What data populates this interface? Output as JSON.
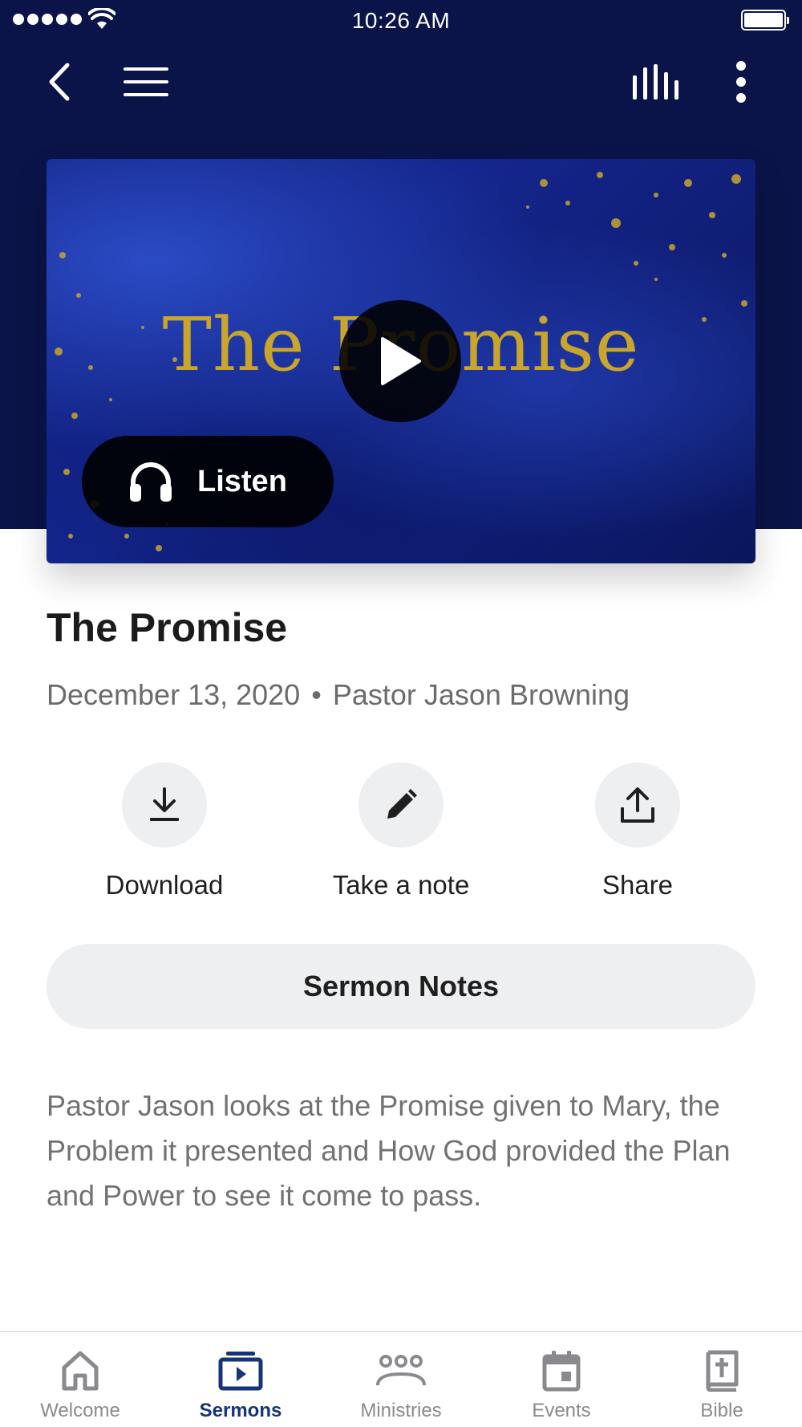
{
  "status_bar": {
    "time": "10:26 AM"
  },
  "header": {
    "back_icon": "chevron-left-icon",
    "menu_icon": "hamburger-icon",
    "audio_icon": "equalizer-icon",
    "more_icon": "vertical-dots-icon"
  },
  "artwork": {
    "text": "The Promise",
    "play_icon": "play-icon",
    "listen_label": "Listen",
    "listen_icon": "headphones-icon"
  },
  "sermon": {
    "title": "The Promise",
    "date": "December 13, 2020",
    "separator": "•",
    "speaker": "Pastor Jason Browning",
    "description": "Pastor Jason looks at the Promise given to Mary, the Problem it presented and How God provided the Plan and Power to see it come to pass."
  },
  "actions": [
    {
      "label": "Download",
      "icon": "download-icon"
    },
    {
      "label": "Take a note",
      "icon": "pencil-icon"
    },
    {
      "label": "Share",
      "icon": "share-icon"
    }
  ],
  "notes_button": {
    "label": "Sermon Notes"
  },
  "tabs": [
    {
      "label": "Welcome",
      "icon": "home-icon",
      "active": false
    },
    {
      "label": "Sermons",
      "icon": "video-library-icon",
      "active": true
    },
    {
      "label": "Ministries",
      "icon": "groups-icon",
      "active": false
    },
    {
      "label": "Events",
      "icon": "calendar-icon",
      "active": false
    },
    {
      "label": "Bible",
      "icon": "bible-icon",
      "active": false
    }
  ],
  "colors": {
    "header_bg": "#0a1448",
    "accent": "#16347a",
    "gold": "#c9a52b",
    "muted_text": "#727272",
    "button_bg": "#eeeff1"
  }
}
